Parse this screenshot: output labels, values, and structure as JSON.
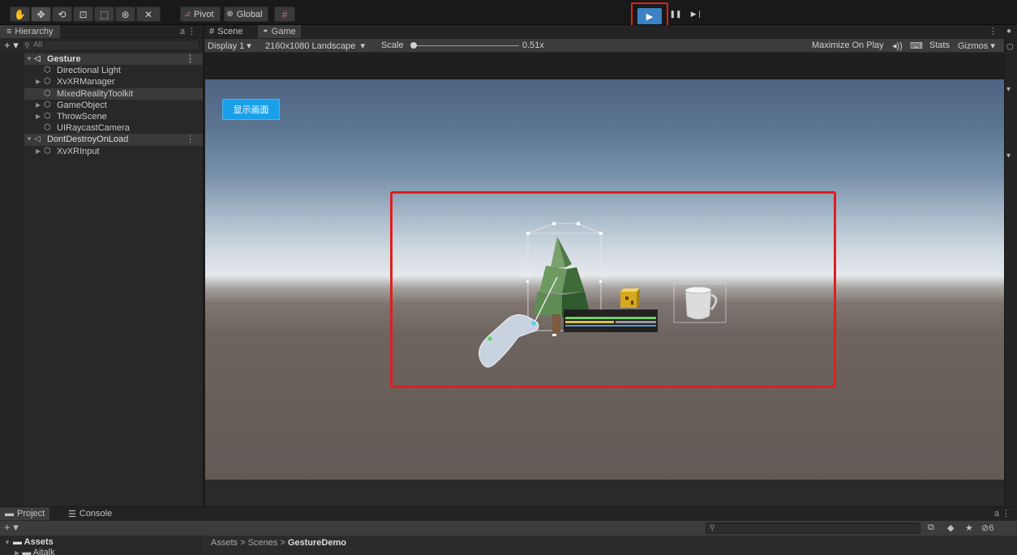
{
  "toolbar": {
    "tools": [
      "hand-icon",
      "move-icon",
      "rotate-icon",
      "scale-icon",
      "rect-icon",
      "transform-icon",
      "custom-tool-icon"
    ],
    "pivot_label": "Pivot",
    "global_label": "Global",
    "grid_icon": "grid-snap-icon",
    "play_icon": "▶",
    "pause_icon": "❚❚",
    "step_icon": "▶❘",
    "play_highlight_color": "#e01e1e"
  },
  "hierarchy": {
    "tab_label": "Hierarchy",
    "search_placeholder": "All",
    "items": [
      {
        "label": "Gesture",
        "type": "scene"
      },
      {
        "label": "Directional Light",
        "type": "object"
      },
      {
        "label": "XvXRManager",
        "type": "object"
      },
      {
        "label": "MixedRealityToolkit",
        "type": "object"
      },
      {
        "label": "GameObject",
        "type": "object"
      },
      {
        "label": "ThrowScene",
        "type": "object"
      },
      {
        "label": "UIRaycastCamera",
        "type": "object"
      },
      {
        "label": "DontDestroyOnLoad",
        "type": "scene"
      },
      {
        "label": "XvXRInput",
        "type": "object"
      }
    ]
  },
  "game": {
    "scene_tab": "Scene",
    "game_tab": "Game",
    "display": "Display 1",
    "resolution": "2160x1080 Landscape",
    "scale_label": "Scale",
    "scale_value": "0.51x",
    "maximize_label": "Maximize On Play",
    "stats_label": "Stats",
    "gizmos_label": "Gizmos",
    "show_button": "显示画面",
    "sky_color": "#5c7592",
    "ground_color": "#635a56",
    "highlight_color": "#e01e1e"
  },
  "project": {
    "project_tab": "Project",
    "console_tab": "Console",
    "assets_label": "Assets",
    "assets_child": "Aitalk",
    "breadcrumb": [
      "Assets",
      "Scenes"
    ],
    "breadcrumb_current": "GestureDemo",
    "hidden_count": "6"
  }
}
